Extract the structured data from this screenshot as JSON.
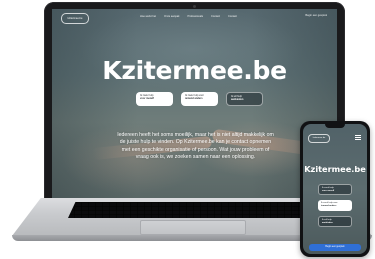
{
  "site": {
    "logo": "kzitermee.be",
    "nav": [
      "Hoe werkt het",
      "Onze aanpak",
      "Professionals",
      "Contact",
      "Contact"
    ],
    "nav_cta": "Begin een gesprek",
    "title": "Kzitermee.be",
    "cards": [
      {
        "line1": "Ik zoek hulp",
        "line2": "voor mezelf"
      },
      {
        "line1": "Ik zoek hulp voor",
        "line2": "iemand anders"
      },
      {
        "line1": "Ik wil hulp",
        "line2": "aanbieden"
      }
    ],
    "paragraph": "Iedereen heeft het soms moeilijk, maar het is niet altijd makkelijk om de juiste hulp te vinden. Op Kzitermee.be kan je contact opnemen met een geschikte organisatie of persoon. Wat jouw probleem of vraag ook is, we zoeken samen naar een oplossing."
  },
  "phone": {
    "logo": "kzitermee.be",
    "title": "Kzitermee.be",
    "cards": [
      {
        "line1": "Ik zoek hulp",
        "line2": "voor mezelf"
      },
      {
        "line1": "Ik zoek hulp voor",
        "line2": "iemand anders"
      },
      {
        "line1": "Ik wil hulp",
        "line2": "aanbieden"
      }
    ],
    "bottom_bar": "Begin een gesprek"
  }
}
